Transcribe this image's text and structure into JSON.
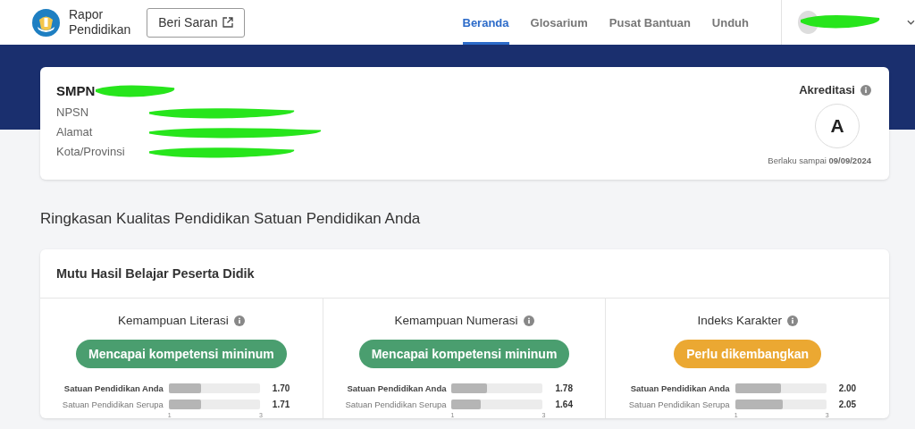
{
  "header": {
    "logo_title": "Rapor",
    "logo_subtitle": "Pendidikan",
    "feedback_button": "Beri Saran",
    "nav": [
      {
        "label": "Beranda",
        "selected": true
      },
      {
        "label": "Glosarium",
        "selected": false
      },
      {
        "label": "Pusat Bantuan",
        "selected": false
      },
      {
        "label": "Unduh",
        "selected": false
      }
    ],
    "user": {
      "redacted": true
    }
  },
  "school": {
    "name": "SMPN",
    "name_redacted": true,
    "fields": [
      {
        "label": "NPSN",
        "redacted": true
      },
      {
        "label": "Alamat",
        "redacted": true
      },
      {
        "label": "Kota/Provinsi",
        "redacted": true
      }
    ],
    "accreditation": {
      "title": "Akreditasi",
      "grade": "A",
      "valid_label": "Berlaku sampai",
      "valid_date": "09/09/2024"
    }
  },
  "summary_title": "Ringkasan Kualitas Pendidikan Satuan Pendidikan Anda",
  "section": {
    "title": "Mutu Hasil Belajar Peserta Didik",
    "metrics": [
      {
        "title": "Kemampuan Literasi",
        "status": "Mencapai kompetensi mininum",
        "color": "#4a9e6f",
        "bars": [
          {
            "label": "Satuan Pendidikan Anda",
            "level": 0.35,
            "value": "1.70",
            "bold": true
          },
          {
            "label": "Satuan Pendidikan Serupa",
            "level": 0.355,
            "value": "1.71",
            "bold": false
          }
        ],
        "ticks": [
          "1",
          "3"
        ]
      },
      {
        "title": "Kemampuan Numerasi",
        "status": "Mencapai kompetensi mininum",
        "color": "#4a9e6f",
        "bars": [
          {
            "label": "Satuan Pendidikan Anda",
            "level": 0.39,
            "value": "1.78",
            "bold": true
          },
          {
            "label": "Satuan Pendidikan Serupa",
            "level": 0.32,
            "value": "1.64",
            "bold": false
          }
        ],
        "ticks": [
          "1",
          "3"
        ]
      },
      {
        "title": "Indeks Karakter",
        "status": "Perlu dikembangkan",
        "color": "#eba832",
        "bars": [
          {
            "label": "Satuan Pendidikan Anda",
            "level": 0.5,
            "value": "2.00",
            "bold": true
          },
          {
            "label": "Satuan Pendidikan Serupa",
            "level": 0.525,
            "value": "2.05",
            "bold": false
          }
        ],
        "ticks": [
          "1",
          "3"
        ]
      }
    ]
  }
}
